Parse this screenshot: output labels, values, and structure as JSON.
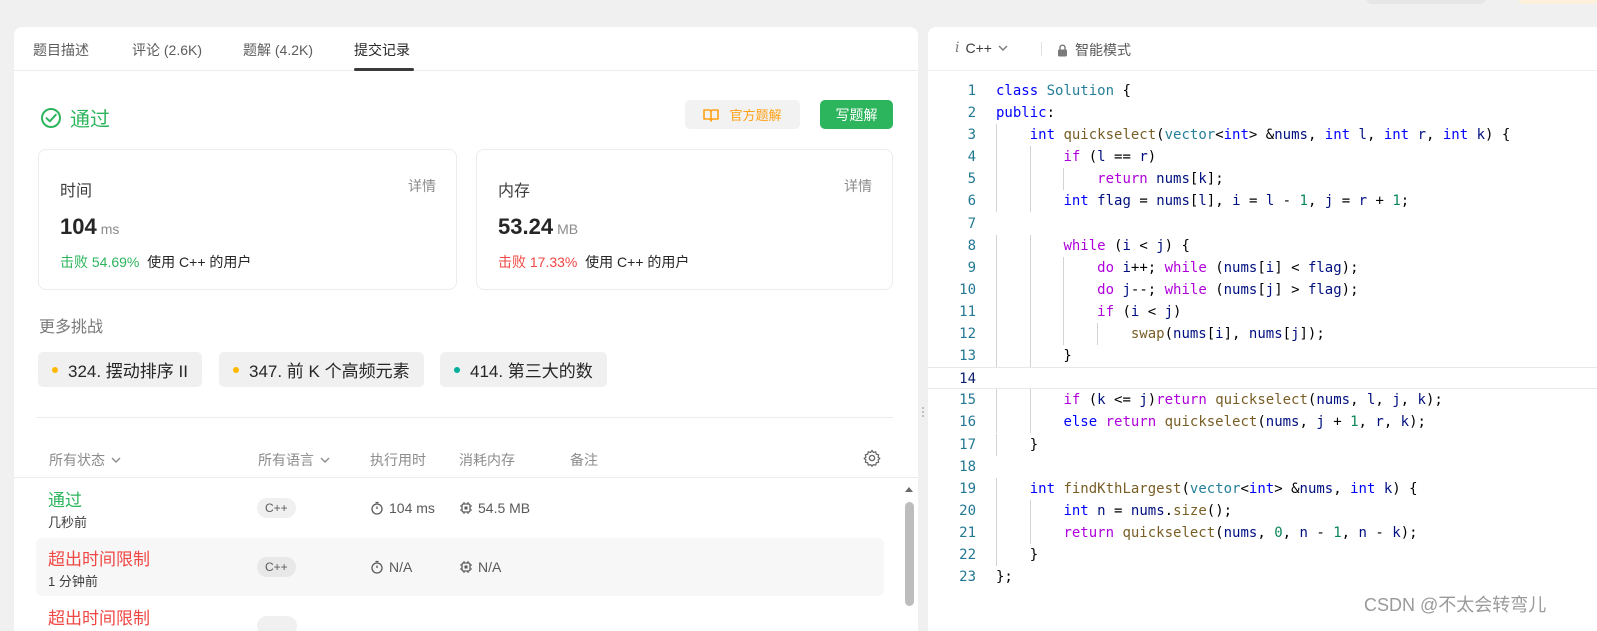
{
  "tabs": [
    {
      "label": "题目描述"
    },
    {
      "label": "评论 (2.6K)"
    },
    {
      "label": "题解 (4.2K)"
    },
    {
      "label": "提交记录"
    }
  ],
  "result": {
    "status": "通过",
    "official_solution_label": "官方题解",
    "write_solution_label": "写题解"
  },
  "stats": {
    "time": {
      "title": "时间",
      "details": "详情",
      "value": "104",
      "unit": "ms",
      "beat_prefix": "击败",
      "beat_pct": "54.69%",
      "beat_suffix": "使用 C++ 的用户"
    },
    "memory": {
      "title": "内存",
      "details": "详情",
      "value": "53.24",
      "unit": "MB",
      "beat_prefix": "击败",
      "beat_pct": "17.33%",
      "beat_suffix": "使用 C++ 的用户"
    }
  },
  "more_challenges": {
    "title": "更多挑战",
    "items": [
      {
        "label": "324. 摆动排序 II",
        "color": "#ffb800"
      },
      {
        "label": "347. 前 K 个高频元素",
        "color": "#ffb800"
      },
      {
        "label": "414. 第三大的数",
        "color": "#00af9b"
      }
    ]
  },
  "submissions_table": {
    "headers": {
      "status": "所有状态",
      "language": "所有语言",
      "runtime": "执行用时",
      "memory": "消耗内存",
      "notes": "备注"
    },
    "rows": [
      {
        "status": "通过",
        "status_color": "#2db55d",
        "time": "几秒前",
        "lang": "C++",
        "runtime": "104 ms",
        "memory": "54.5 MB"
      },
      {
        "status": "超出时间限制",
        "status_color": "#ef4743",
        "time": "1 分钟前",
        "lang": "C++",
        "runtime": "N/A",
        "memory": "N/A"
      },
      {
        "status": "超出时间限制",
        "status_color": "#ef4743",
        "time": "",
        "lang": "",
        "runtime": "",
        "memory": ""
      }
    ]
  },
  "editor": {
    "language": "C++",
    "mode": "智能模式",
    "lines": [
      "class Solution {",
      "public:",
      "    int quickselect(vector<int> &nums, int l, int r, int k) {",
      "        if (l == r)",
      "            return nums[k];",
      "        int flag = nums[l], i = l - 1, j = r + 1;",
      "",
      "        while (i < j) {",
      "            do i++; while (nums[i] < flag);",
      "            do j--; while (nums[j] > flag);",
      "            if (i < j)",
      "                swap(nums[i], nums[j]);",
      "        }",
      "",
      "        if (k <= j)return quickselect(nums, l, j, k);",
      "        else return quickselect(nums, j + 1, r, k);",
      "    }",
      "",
      "    int findKthLargest(vector<int> &nums, int k) {",
      "        int n = nums.size();",
      "        return quickselect(nums, 0, n - 1, n - k);",
      "    }",
      "};"
    ]
  },
  "watermark": "CSDN @不太会转弯儿"
}
